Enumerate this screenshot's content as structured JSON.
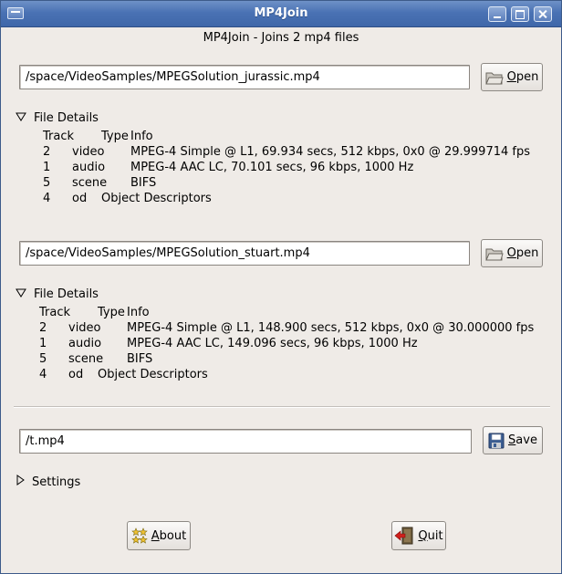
{
  "window": {
    "title": "MP4Join"
  },
  "header": {
    "text": "MP4Join - Joins 2 mp4 files"
  },
  "file1": {
    "path": "/space/VideoSamples/MPEGSolution_jurassic.mp4",
    "open_label": "Open",
    "details_label": "File Details",
    "headers": {
      "track": "Track",
      "type": "Type",
      "info": "Info"
    },
    "rows": [
      {
        "track": "2",
        "type": "video",
        "info": "MPEG-4 Simple @ L1, 69.934 secs, 512 kbps, 0x0 @ 29.999714 fps"
      },
      {
        "track": "1",
        "type": "audio",
        "info": "MPEG-4 AAC LC, 70.101 secs, 96 kbps, 1000 Hz"
      },
      {
        "track": "5",
        "type": "scene",
        "info": "BIFS"
      },
      {
        "track": "4",
        "type": "od",
        "info": "Object Descriptors"
      }
    ]
  },
  "file2": {
    "path": "/space/VideoSamples/MPEGSolution_stuart.mp4",
    "open_label": "Open",
    "details_label": "File Details",
    "headers": {
      "track": "Track",
      "type": "Type",
      "info": "Info"
    },
    "rows": [
      {
        "track": "2",
        "type": "video",
        "info": "MPEG-4 Simple @ L1, 148.900 secs, 512 kbps, 0x0 @ 30.000000 fps"
      },
      {
        "track": "1",
        "type": "audio",
        "info": "MPEG-4 AAC LC, 149.096 secs, 96 kbps, 1000 Hz"
      },
      {
        "track": "5",
        "type": "scene",
        "info": "BIFS"
      },
      {
        "track": "4",
        "type": "od",
        "info": "Object Descriptors"
      }
    ]
  },
  "output": {
    "path": "/t.mp4",
    "save_label": "Save"
  },
  "settings": {
    "label": "Settings"
  },
  "footer": {
    "about_label": "About",
    "quit_label": "Quit"
  }
}
